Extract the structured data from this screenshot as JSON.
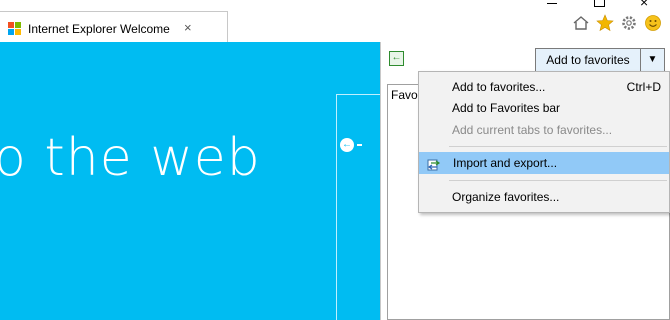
{
  "tab": {
    "title": "Internet Explorer Welcome",
    "close_glyph": "×"
  },
  "window": {
    "close_glyph": "×"
  },
  "content": {
    "hero_text": "o the web",
    "side_arrow_glyph": "←"
  },
  "favorites": {
    "add_button_label": "Add to favorites",
    "dropdown_glyph": "▼",
    "pin_glyph": "←",
    "tab_label": "Favo"
  },
  "menu": {
    "items": [
      {
        "label": "Add to favorites...",
        "shortcut": "Ctrl+D",
        "enabled": true
      },
      {
        "label": "Add to Favorites bar",
        "shortcut": "",
        "enabled": true
      },
      {
        "label": "Add current tabs to favorites...",
        "shortcut": "",
        "enabled": false
      },
      {
        "label": "Import and export...",
        "shortcut": "",
        "enabled": true,
        "highlighted": true
      },
      {
        "label": "Organize favorites...",
        "shortcut": "",
        "enabled": true
      }
    ]
  },
  "colors": {
    "page_blue": "#00bcf2",
    "menu_highlight": "#91c9f7",
    "star": "#f2b600",
    "smiley": "#f6c21b"
  },
  "icons": [
    "ie-logo-icon",
    "home-icon",
    "star-icon",
    "gear-icon",
    "smiley-icon",
    "import-export-icon",
    "pin-arrow-icon"
  ]
}
